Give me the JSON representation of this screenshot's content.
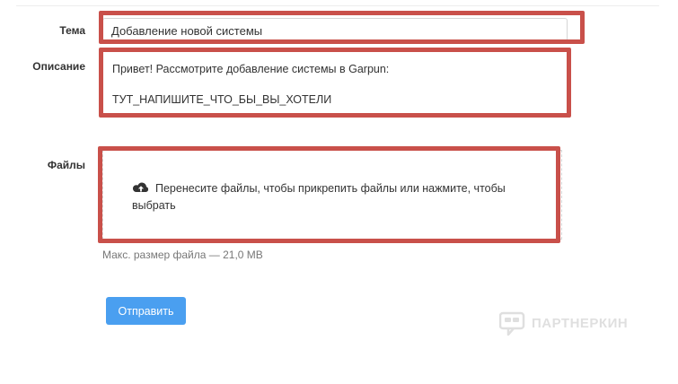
{
  "form": {
    "subject": {
      "label": "Тема",
      "value": "Добавление новой системы"
    },
    "description": {
      "label": "Описание",
      "line1": "Привет! Рассмотрите добавление системы в Garpun:",
      "line2": "ТУТ_НАПИШИТЕ_ЧТО_БЫ_ВЫ_ХОТЕЛИ"
    },
    "files": {
      "label": "Файлы",
      "icon": "cloud-upload-icon",
      "dropzone_text": "Перенесите файлы, чтобы прикрепить файлы или нажмите, чтобы выбрать",
      "max_size_hint": "Макс. размер файла — 21,0 MB"
    },
    "submit_label": "Отправить"
  },
  "watermark": {
    "text": "ПАРТНЕРКИН"
  },
  "colors": {
    "highlight_frame": "#c9504a",
    "primary_button": "#4a9ff0",
    "hint_text": "#777777"
  }
}
